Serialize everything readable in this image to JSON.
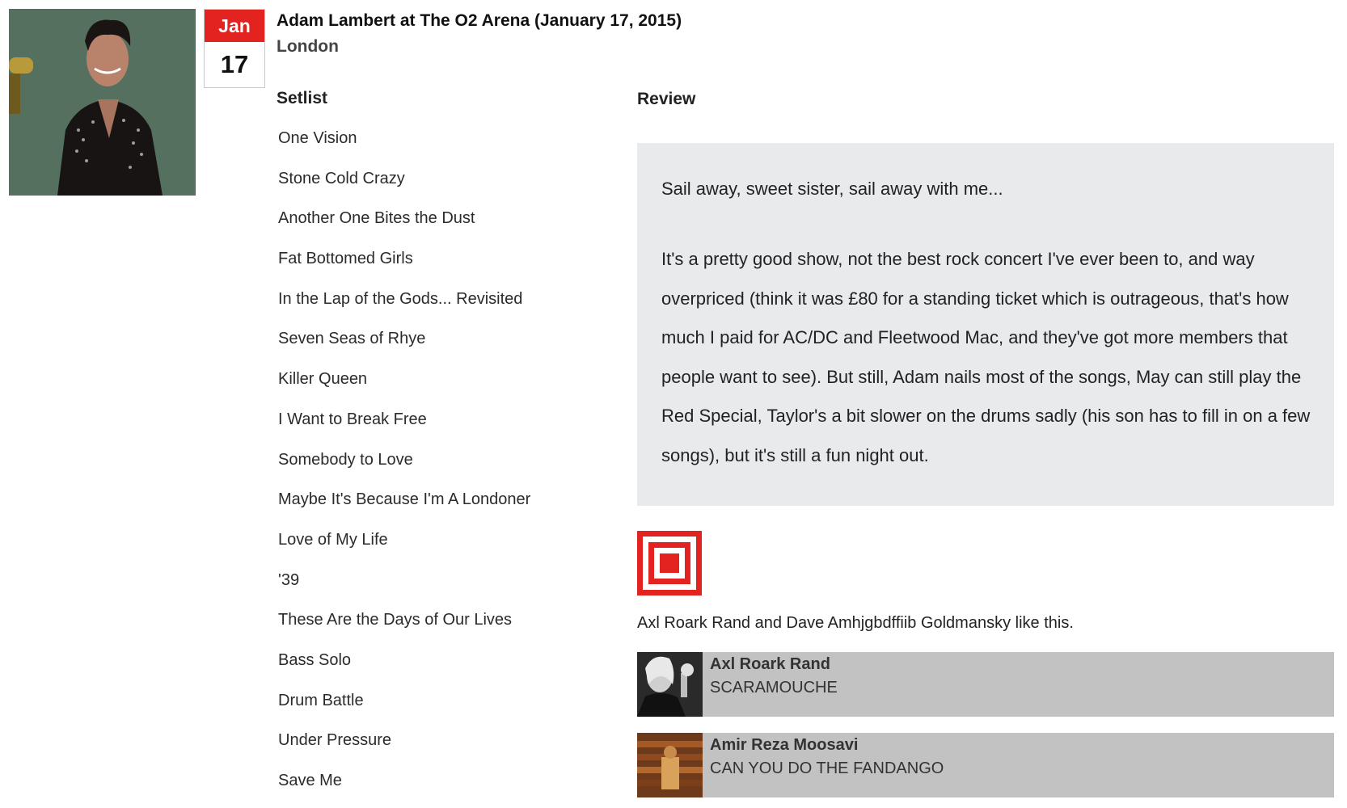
{
  "event": {
    "date": {
      "month": "Jan",
      "day": "17"
    },
    "title": "Adam Lambert at The O2 Arena (January 17, 2015)",
    "city": "London"
  },
  "setlist": {
    "heading": "Setlist",
    "songs": [
      "One Vision",
      "Stone Cold Crazy",
      "Another One Bites the Dust",
      "Fat Bottomed Girls",
      "In the Lap of the Gods... Revisited",
      "Seven Seas of Rhye",
      "Killer Queen",
      "I Want to Break Free",
      "Somebody to Love",
      "Maybe It's Because I'm A Londoner",
      "Love of My Life",
      "'39",
      "These Are the Days of Our Lives",
      "Bass Solo",
      "Drum Battle",
      "Under Pressure",
      "Save Me"
    ]
  },
  "review": {
    "heading": "Review",
    "intro": "Sail away, sweet sister, sail away with me...",
    "body": "It's a pretty good show, not the best rock concert I've ever been to, and way overpriced (think it was £80 for a standing ticket which is outrageous, that's how much I paid for AC/DC and Fleetwood Mac, and they've got more members that people want to see). But still, Adam nails most of the songs, May can still play the Red Special, Taylor's a bit slower on the drums sadly (his son has to fill in on a few songs), but it's still a fun night out."
  },
  "likes": {
    "icon": "like-icon",
    "summary": "Axl Roark Rand and Dave Amhjgbdffiib Goldmansky like this.",
    "users": [
      {
        "name": "Axl Roark Rand",
        "label": "SCARAMOUCHE"
      },
      {
        "name": "Amir Reza Moosavi",
        "label": "CAN YOU DO THE FANDANGO"
      }
    ]
  },
  "colors": {
    "accent": "#e3231f",
    "review_bg": "#e9eaec",
    "liker_bg": "#c2c2c2"
  }
}
